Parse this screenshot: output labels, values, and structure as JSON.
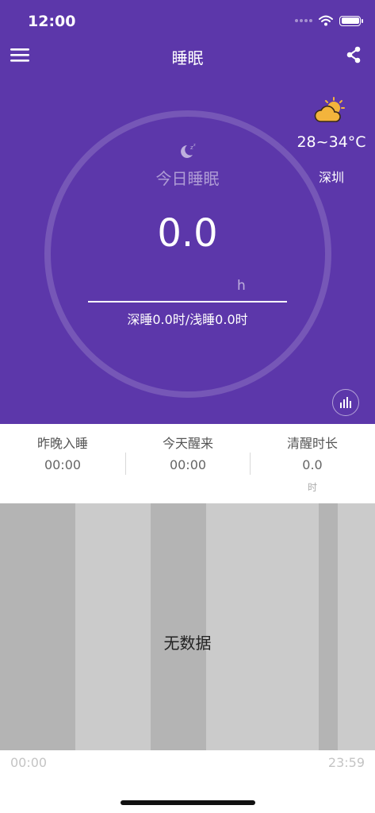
{
  "status_bar": {
    "time": "12:00"
  },
  "nav": {
    "title": "睡眠"
  },
  "sleep": {
    "today_label": "今日睡眠",
    "value": "0.0",
    "unit": "h",
    "deep_light": "深睡0.0时/浅睡0.0时"
  },
  "weather": {
    "temperature": "28~34°C",
    "city": "深圳",
    "icon": "partly-cloudy-icon"
  },
  "summary": [
    {
      "label": "昨晚入睡",
      "value": "00:00",
      "unit": ""
    },
    {
      "label": "今天醒来",
      "value": "00:00",
      "unit": ""
    },
    {
      "label": "清醒时长",
      "value": "0.0",
      "unit": "时"
    }
  ],
  "chart": {
    "empty_text": "无数据",
    "axis_start": "00:00",
    "axis_end": "23:59"
  },
  "colors": {
    "primary": "#5c37aa",
    "band_light": "#cbcbcb",
    "band_dark": "#b4b4b4",
    "sun": "#f3b43c"
  }
}
